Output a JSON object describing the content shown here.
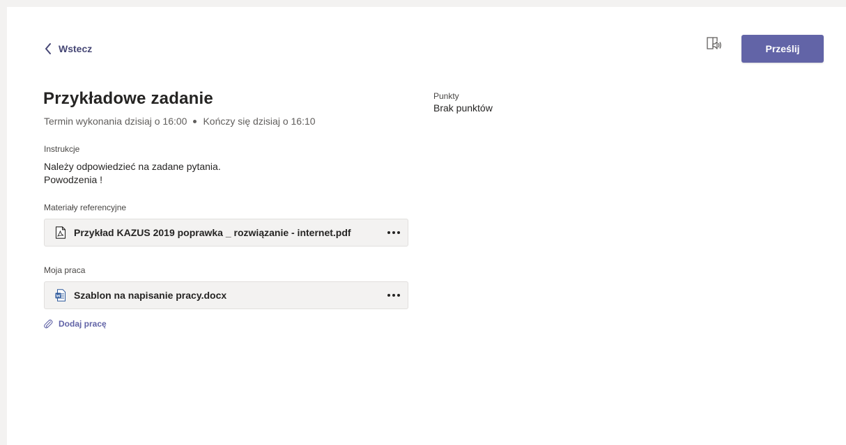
{
  "header": {
    "back_label": "Wstecz",
    "submit_label": "Prześlij"
  },
  "assignment": {
    "title": "Przykładowe zadanie",
    "due": "Termin wykonania dzisiaj o 16:00",
    "closes": "Kończy się dzisiaj o 16:10"
  },
  "instructions": {
    "label": "Instrukcje",
    "line1": "Należy odpowiedzieć na zadane pytania.",
    "line2": "Powodzenia !"
  },
  "reference": {
    "label": "Materiały referencyjne",
    "file": {
      "name": "Przykład KAZUS 2019 poprawka _ rozwiązanie - internet.pdf",
      "icon": "pdf-file-icon"
    }
  },
  "my_work": {
    "label": "Moja praca",
    "file": {
      "name": "Szablon na napisanie pracy.docx",
      "icon": "word-file-icon"
    },
    "add_label": "Dodaj pracę"
  },
  "points": {
    "label": "Punkty",
    "value": "Brak punktów"
  },
  "colors": {
    "accent": "#6264a7",
    "word_blue": "#2b579a"
  }
}
